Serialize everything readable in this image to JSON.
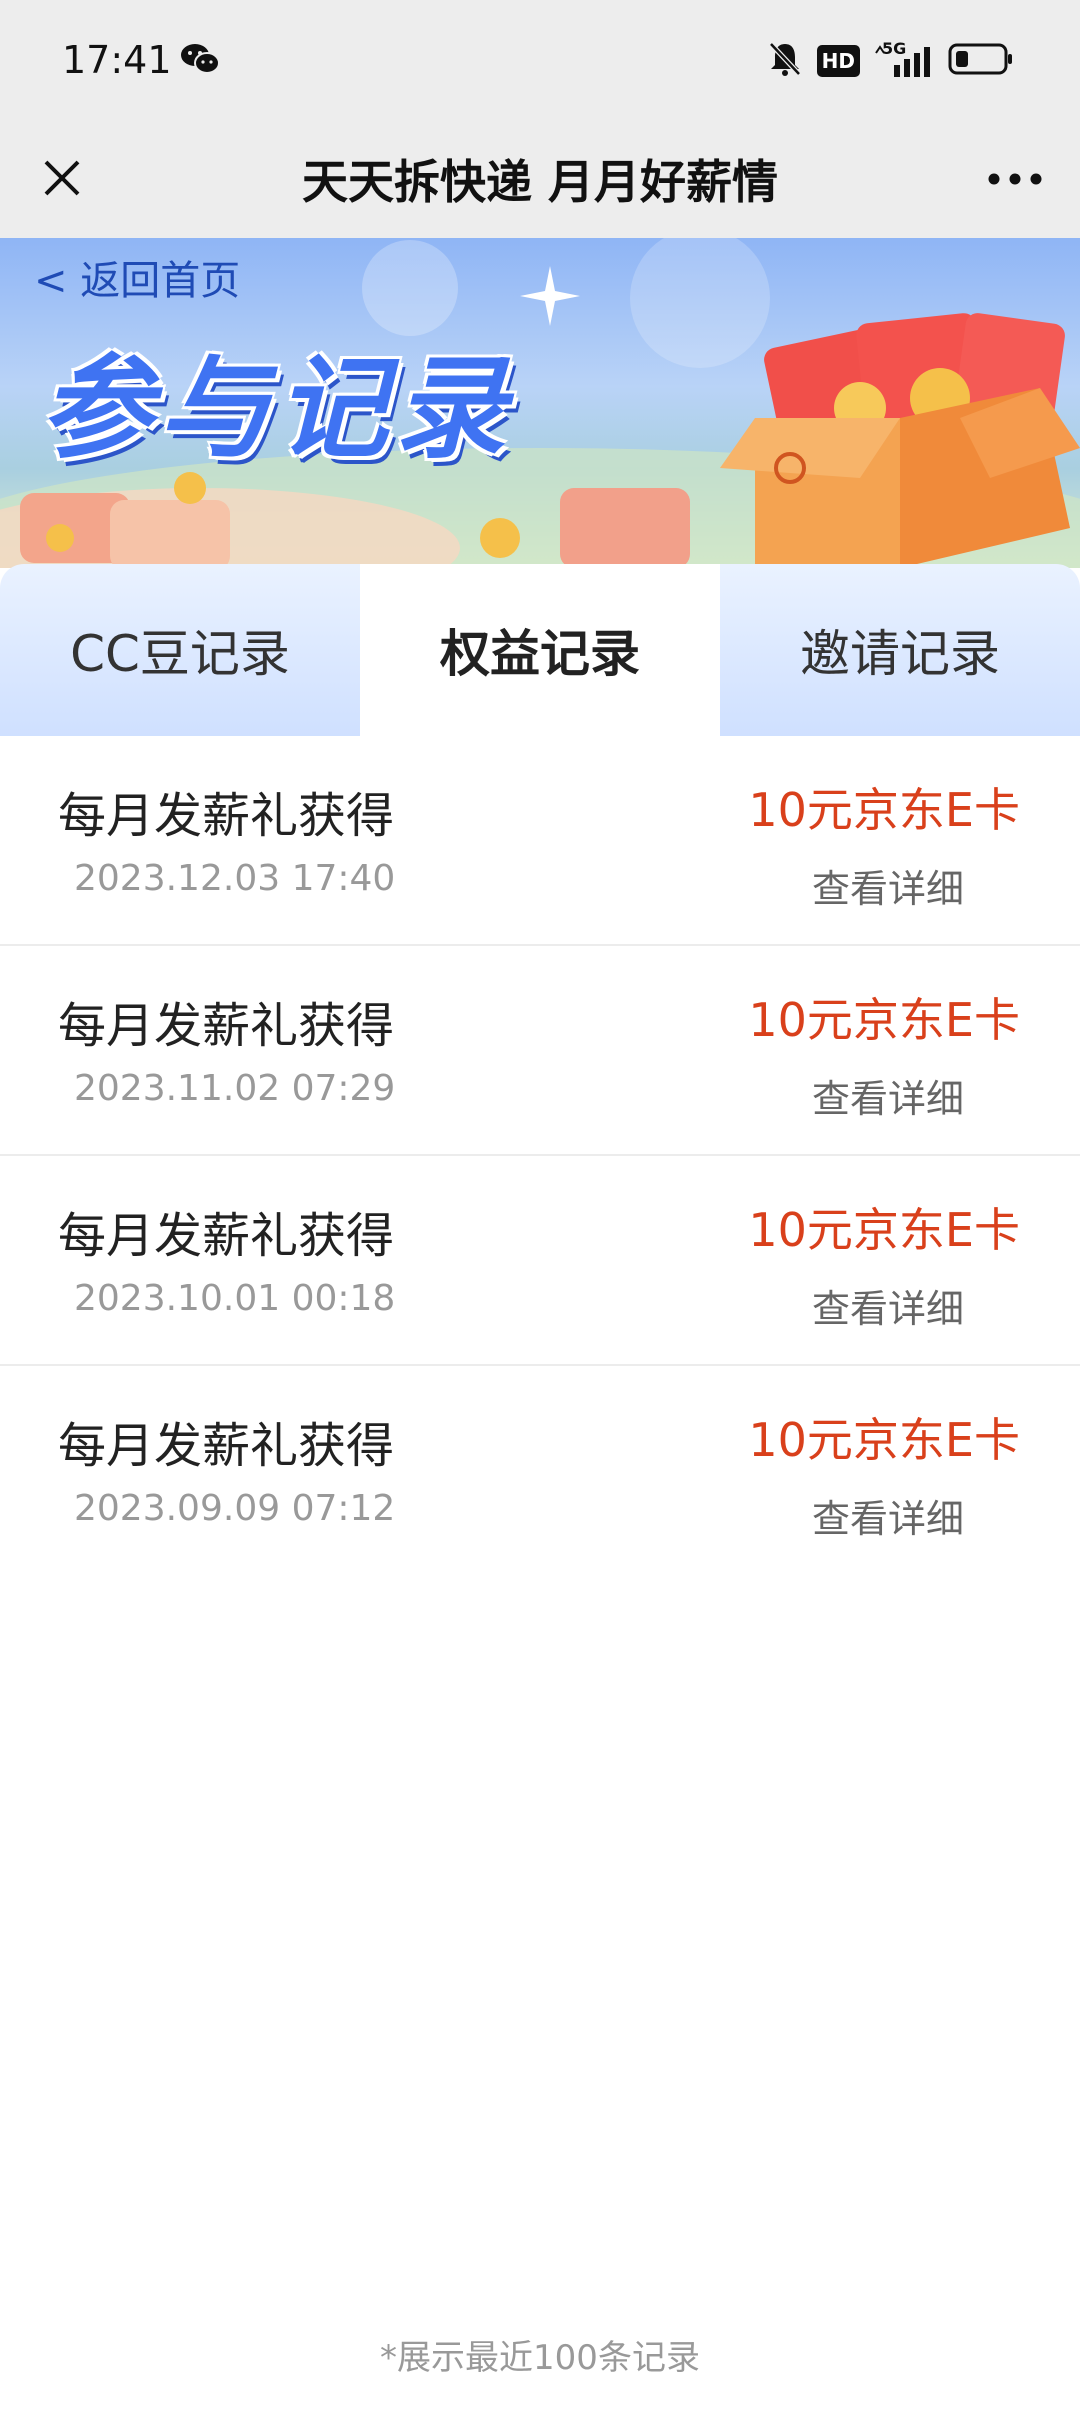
{
  "status_bar": {
    "time": "17:41",
    "hd_label": "HD",
    "network_label": "5G"
  },
  "header": {
    "title": "天天拆快递 月月好薪情"
  },
  "banner": {
    "back_label": "< 返回首页",
    "title": "参与记录"
  },
  "tabs": [
    {
      "label": "CC豆记录",
      "active": false
    },
    {
      "label": "权益记录",
      "active": true
    },
    {
      "label": "邀请记录",
      "active": false
    }
  ],
  "records": [
    {
      "title": "每月发薪礼获得",
      "date": "2023.12.03 17:40",
      "prize": "10元京东E卡",
      "detail": "查看详细"
    },
    {
      "title": "每月发薪礼获得",
      "date": "2023.11.02 07:29",
      "prize": "10元京东E卡",
      "detail": "查看详细"
    },
    {
      "title": "每月发薪礼获得",
      "date": "2023.10.01 00:18",
      "prize": "10元京东E卡",
      "detail": "查看详细"
    },
    {
      "title": "每月发薪礼获得",
      "date": "2023.09.09 07:12",
      "prize": "10元京东E卡",
      "detail": "查看详细"
    }
  ],
  "footer": {
    "note": "*展示最近100条记录"
  },
  "colors": {
    "accent_red": "#d9401b",
    "banner_blue": "#3f73f2"
  }
}
